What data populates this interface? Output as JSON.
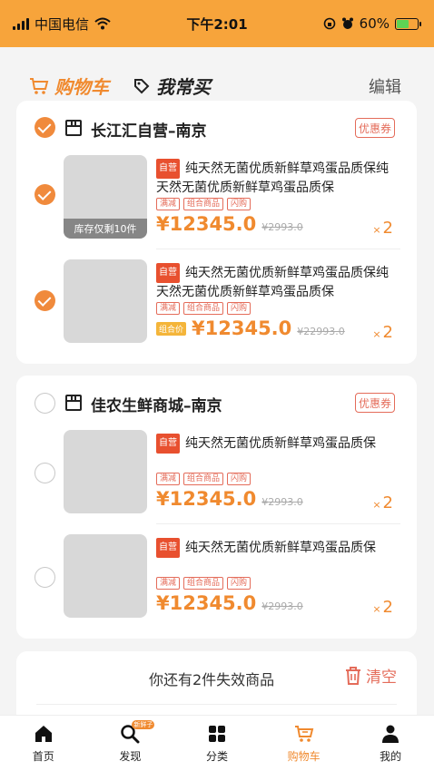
{
  "status_bar": {
    "carrier": "中国电信",
    "time": "下午2:01",
    "battery_percent": "60%",
    "battery_level": 0.6
  },
  "header": {
    "tab_cart": "购物车",
    "tab_often": "我常买",
    "edit": "编辑"
  },
  "stores": [
    {
      "name": "长江汇自营–南京",
      "checked": true,
      "coupon": "优惠券",
      "items": [
        {
          "checked": true,
          "self_badge": "自营",
          "title": "纯天然无菌优质新鲜草鸡蛋品质保纯天然无菌优质新鲜草鸡蛋品质保",
          "tags": [
            "满减",
            "组合商品",
            "闪购"
          ],
          "stock_note": "库存仅剩10件",
          "combo_badge": "",
          "price": "¥12345.0",
          "original_price": "¥2993.0",
          "qty_x": "×",
          "qty": "2"
        },
        {
          "checked": true,
          "self_badge": "自营",
          "title": "纯天然无菌优质新鲜草鸡蛋品质保纯天然无菌优质新鲜草鸡蛋品质保",
          "tags": [
            "满减",
            "组合商品",
            "闪购"
          ],
          "stock_note": "",
          "combo_badge": "组合价",
          "price": "¥12345.0",
          "original_price": "¥22993.0",
          "qty_x": "×",
          "qty": "2"
        }
      ]
    },
    {
      "name": "佳农生鲜商城–南京",
      "checked": false,
      "coupon": "优惠券",
      "items": [
        {
          "checked": false,
          "self_badge": "自营",
          "title": "纯天然无菌优质新鲜草鸡蛋品质保",
          "tags": [
            "满减",
            "组合商品",
            "闪购"
          ],
          "stock_note": "",
          "combo_badge": "",
          "price": "¥12345.0",
          "original_price": "¥2993.0",
          "qty_x": "×",
          "qty": "2"
        },
        {
          "checked": false,
          "self_badge": "自营",
          "title": "纯天然无菌优质新鲜草鸡蛋品质保",
          "tags": [
            "满减",
            "组合商品",
            "闪购"
          ],
          "stock_note": "",
          "combo_badge": "",
          "price": "¥12345.0",
          "original_price": "¥2993.0",
          "qty_x": "×",
          "qty": "2"
        }
      ]
    }
  ],
  "invalid": {
    "text": "你还有2件失效商品",
    "clear": "清空"
  },
  "tabbar": {
    "items": [
      {
        "label": "首页",
        "icon": "home-icon",
        "active": false
      },
      {
        "label": "发现",
        "icon": "discover-icon",
        "active": false,
        "badge": "新鲜子"
      },
      {
        "label": "分类",
        "icon": "category-icon",
        "active": false
      },
      {
        "label": "购物车",
        "icon": "cart-icon",
        "active": true
      },
      {
        "label": "我的",
        "icon": "profile-icon",
        "active": false
      }
    ]
  },
  "colors": {
    "accent": "#f08a2f",
    "status_bar": "#f7a43b",
    "tag_red": "#e46c5a"
  }
}
